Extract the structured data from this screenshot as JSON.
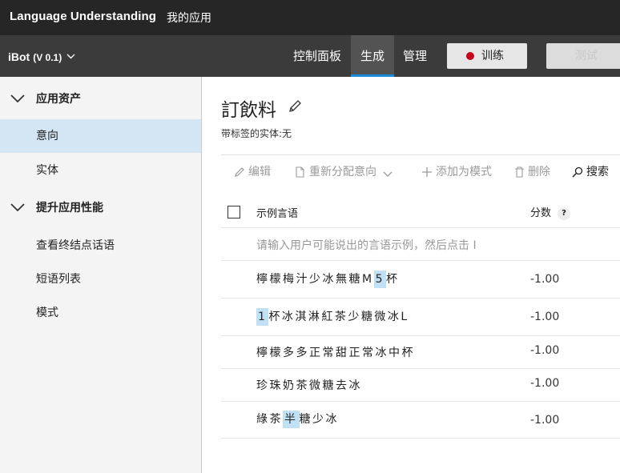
{
  "topbar": {
    "brand": "Language Understanding",
    "my_apps": "我的应用"
  },
  "appbar": {
    "app_name": "iBot",
    "version": "(V 0.1)",
    "tabs": [
      {
        "label": "控制面板",
        "active": false
      },
      {
        "label": "生成",
        "active": true
      },
      {
        "label": "管理",
        "active": false
      }
    ],
    "train_label": "训练",
    "test_label": "测试"
  },
  "sidebar": {
    "section_assets": "应用资产",
    "item_intents": "意向",
    "item_entities": "实体",
    "section_perf": "提升应用性能",
    "item_review": "查看终结点话语",
    "item_phrases": "短语列表",
    "item_patterns": "模式"
  },
  "intent": {
    "title": "訂飲料",
    "labeled_entities": "带标签的实体:无"
  },
  "toolbar": {
    "edit": "编辑",
    "reassign": "重新分配意向",
    "add_pattern": "添加为模式",
    "delete": "删除",
    "search": "搜索"
  },
  "table": {
    "col_utterance": "示例言语",
    "col_score": "分数",
    "help": "?",
    "input_placeholder": "请输入用户可能说出的言语示例，然后点击 I",
    "rows": [
      {
        "pre": "檸檬梅汁少冰無糖M",
        "entity": "5",
        "post": "杯",
        "score": "-1.00"
      },
      {
        "pre": "",
        "entity": "1",
        "post": "杯冰淇淋紅茶少糖微冰L",
        "score": "-1.00"
      },
      {
        "text": "檸檬多多正常甜正常冰中杯",
        "score": "-1.00"
      },
      {
        "text": "珍珠奶茶微糖去冰",
        "score": "-1.00"
      },
      {
        "pre": "綠茶",
        "entity": "半",
        "post": "糖少冰",
        "score": "-1.00"
      }
    ]
  },
  "colors": {
    "accent": "#1a8bd6",
    "entity_highlight": "#bfe0f5",
    "record_dot": "#c5001c",
    "topbar": "#262626",
    "appbar": "#3b3b3b"
  }
}
